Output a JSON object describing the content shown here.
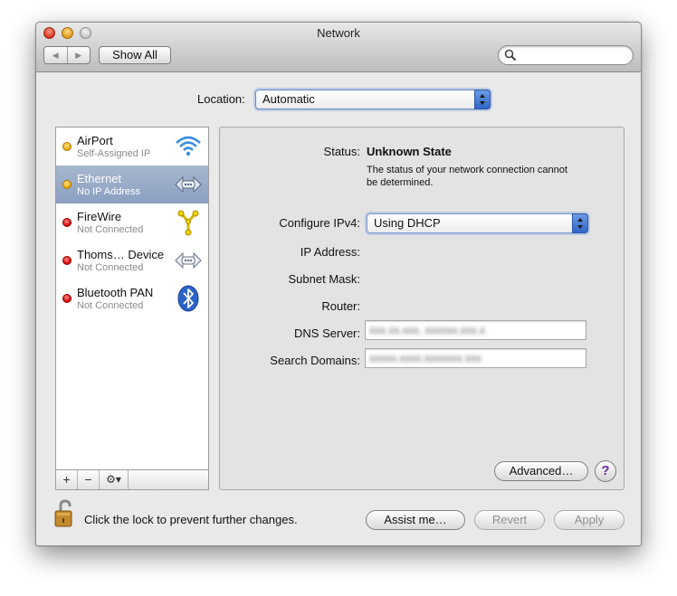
{
  "window": {
    "title": "Network"
  },
  "toolbar": {
    "back_label": "◀",
    "forward_label": "▶",
    "show_all_label": "Show All",
    "search_value": "",
    "search_placeholder": ""
  },
  "location": {
    "label": "Location:",
    "value": "Automatic"
  },
  "services": [
    {
      "name": "AirPort",
      "status": "Self-Assigned IP",
      "status_color": "yellow",
      "icon": "wifi-icon",
      "selected": false
    },
    {
      "name": "Ethernet",
      "status": "No IP Address",
      "status_color": "yellow",
      "icon": "ethernet-icon",
      "selected": true
    },
    {
      "name": "FireWire",
      "status": "Not Connected",
      "status_color": "red",
      "icon": "firewire-icon",
      "selected": false
    },
    {
      "name": "Thoms… Device",
      "status": "Not Connected",
      "status_color": "red",
      "icon": "ethernet-icon",
      "selected": false
    },
    {
      "name": "Bluetooth PAN",
      "status": "Not Connected",
      "status_color": "red",
      "icon": "bluetooth-icon",
      "selected": false
    }
  ],
  "sidebar_toolbar": {
    "add_label": "+",
    "remove_label": "−",
    "gear_label": "⚙▾"
  },
  "detail": {
    "status_label": "Status:",
    "status_value": "Unknown State",
    "status_description": "The status of your network connection cannot be determined.",
    "configure_label": "Configure IPv4:",
    "configure_value": "Using DHCP",
    "ip_label": "IP Address:",
    "subnet_label": "Subnet Mask:",
    "router_label": "Router:",
    "dns_label": "DNS Server:",
    "dns_value": "xxx.xx.xxx, xxxxxx.xxx.x",
    "search_domains_label": "Search Domains:",
    "search_domains_value": "xxxxx.xxxx.xxxxxxx.xxx",
    "advanced_label": "Advanced…",
    "help_label": "?"
  },
  "footer": {
    "lock_text": "Click the lock to prevent further changes.",
    "assist_label": "Assist me…",
    "revert_label": "Revert",
    "apply_label": "Apply"
  },
  "colors": {
    "selection": "#8a9fc0",
    "status_yellow": "#e8a500",
    "status_red": "#d00000",
    "popup_accent": "#2f65c8",
    "help_accent": "#6a2ba8"
  }
}
